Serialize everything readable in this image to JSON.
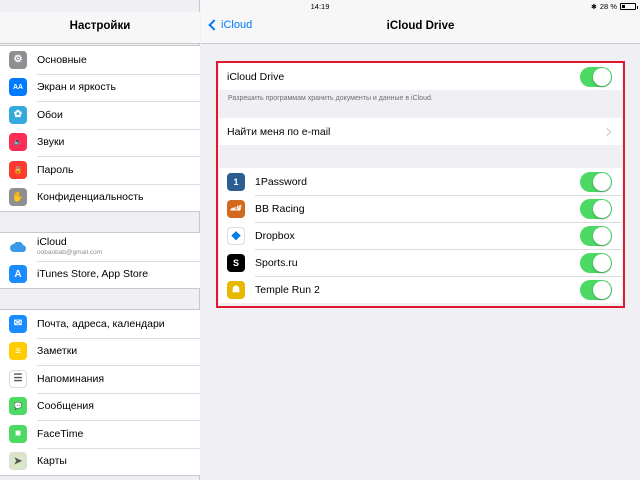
{
  "status": {
    "device": "iPad",
    "time": "14:19",
    "battery_text": "28 %",
    "battery_level": 0.28
  },
  "sidebar": {
    "title": "Настройки",
    "group1": [
      {
        "label": "Основные",
        "icon": "gear-icon",
        "color": "#8e8e93",
        "glyph": "⚙"
      },
      {
        "label": "Экран и яркость",
        "icon": "brightness-icon",
        "color": "#007aff",
        "glyph": "AA"
      },
      {
        "label": "Обои",
        "icon": "wallpaper-icon",
        "color": "#34aadc",
        "glyph": "✿"
      },
      {
        "label": "Звуки",
        "icon": "sounds-icon",
        "color": "#ff2d55",
        "glyph": "🔈"
      },
      {
        "label": "Пароль",
        "icon": "lock-icon",
        "color": "#ff3b30",
        "glyph": "🔒"
      },
      {
        "label": "Конфиденциальность",
        "icon": "hand-icon",
        "color": "#8e8e93",
        "glyph": "✋"
      }
    ],
    "icloud": {
      "label": "iCloud",
      "email": "oobaobab@gmail.com",
      "icon": "icloud-icon"
    },
    "itunes": {
      "label": "iTunes Store, App Store",
      "icon": "app-store-icon",
      "color": "#1a8cff",
      "glyph": "A"
    },
    "group3": [
      {
        "label": "Почта, адреса, календари",
        "icon": "mail-icon",
        "color": "#1a8cff",
        "glyph": "✉"
      },
      {
        "label": "Заметки",
        "icon": "notes-icon",
        "color": "#ffcc00",
        "glyph": "≡"
      },
      {
        "label": "Напоминания",
        "icon": "reminders-icon",
        "color": "#ffffff",
        "glyph": "☰"
      },
      {
        "label": "Сообщения",
        "icon": "messages-icon",
        "color": "#4cd964",
        "glyph": "💬"
      },
      {
        "label": "FaceTime",
        "icon": "facetime-icon",
        "color": "#4cd964",
        "glyph": "■"
      },
      {
        "label": "Карты",
        "icon": "maps-icon",
        "color": "#d9e6c8",
        "glyph": "➤"
      }
    ]
  },
  "main": {
    "back_label": "iCloud",
    "title": "iCloud Drive",
    "drive_toggle": {
      "label": "iCloud Drive",
      "on": true
    },
    "footnote": "Разрешить программам хранить документы и данные в iCloud.",
    "find_me": "Найти меня по e-mail",
    "apps": [
      {
        "name": "1Password",
        "icon": "onepassword-icon",
        "color": "#2c5d91",
        "glyph": "1",
        "on": true
      },
      {
        "name": "BB Racing",
        "icon": "bb-racing-icon",
        "color": "#d2691e",
        "glyph": "🏎",
        "on": true
      },
      {
        "name": "Dropbox",
        "icon": "dropbox-icon",
        "color": "#ffffff",
        "glyph": "❖",
        "on": true
      },
      {
        "name": "Sports.ru",
        "icon": "sports-ru-icon",
        "color": "#000000",
        "glyph": "S",
        "on": true
      },
      {
        "name": "Temple Run 2",
        "icon": "temple-run-icon",
        "color": "#e6b800",
        "glyph": "☗",
        "on": true
      }
    ],
    "toggle_color": "#4cd964",
    "highlight_color": "#e0182e"
  }
}
